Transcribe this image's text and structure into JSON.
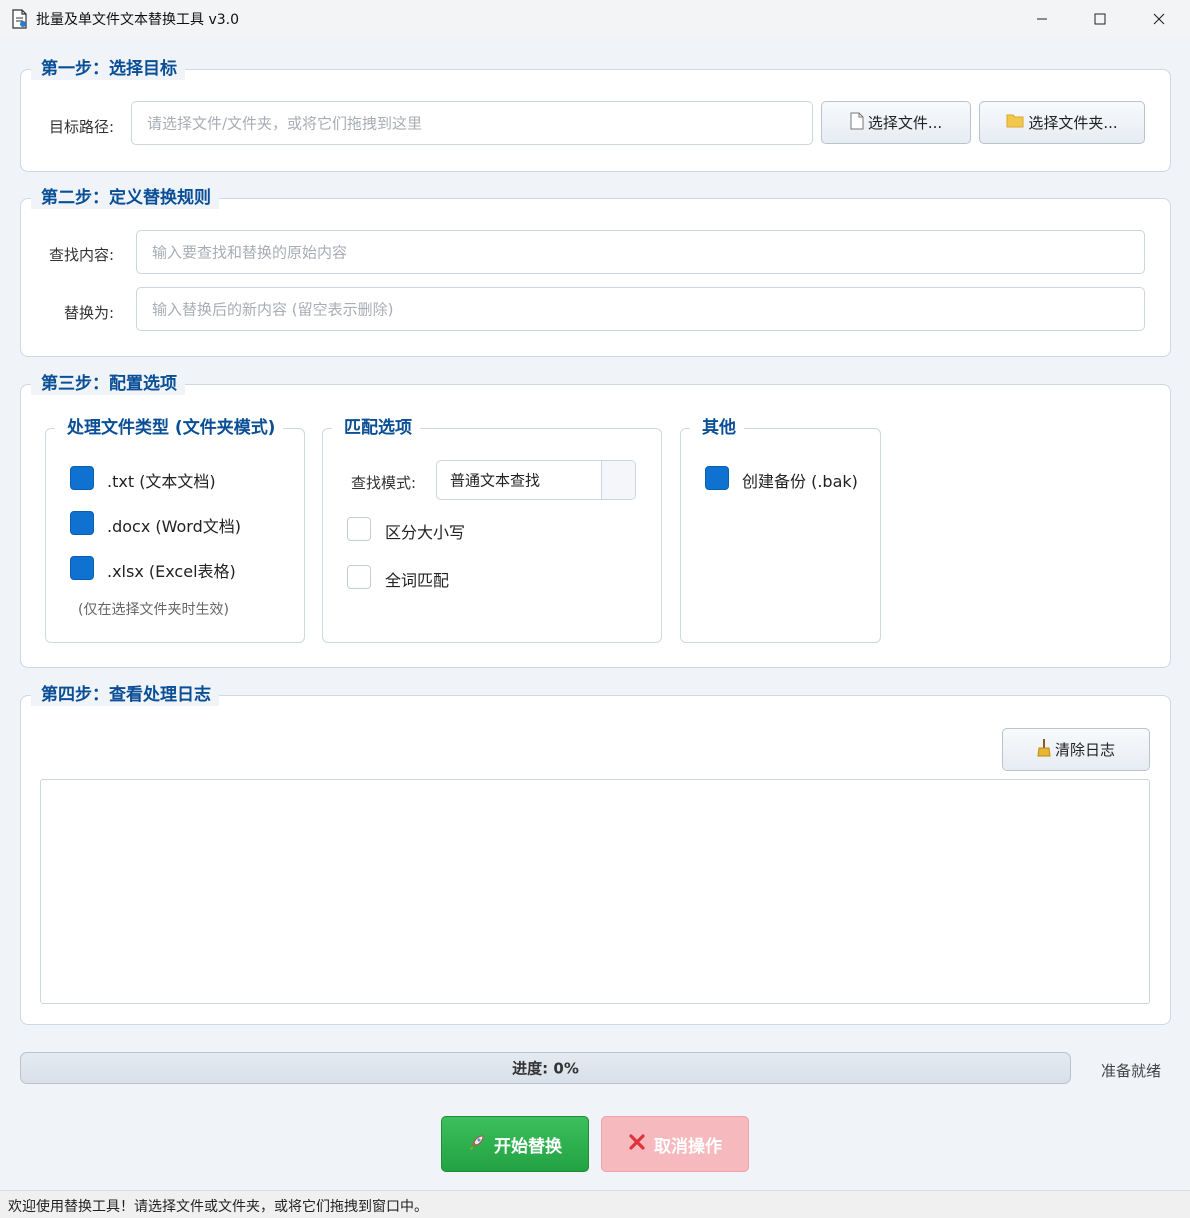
{
  "window": {
    "title": "批量及单文件文本替换工具 v3.0",
    "icons": [
      "app-document-icon",
      "minimize-icon",
      "maximize-icon",
      "close-icon"
    ]
  },
  "step1": {
    "title": "第一步：选择目标",
    "path_label": "目标路径:",
    "path_placeholder": "请选择文件/文件夹，或将它们拖拽到这里",
    "select_file_button": "选择文件...",
    "select_folder_button": "选择文件夹..."
  },
  "step2": {
    "title": "第二步：定义替换规则",
    "find_label": "查找内容:",
    "find_placeholder": "输入要查找和替换的原始内容",
    "replace_label": "替换为:",
    "replace_placeholder": "输入替换后的新内容 (留空表示删除)"
  },
  "step3": {
    "title": "第三步：配置选项",
    "file_types": {
      "title": "处理文件类型 (文件夹模式)",
      "options": [
        {
          "label": ".txt (文本文档)",
          "checked": true
        },
        {
          "label": ".docx (Word文档)",
          "checked": true
        },
        {
          "label": ".xlsx (Excel表格)",
          "checked": true
        }
      ],
      "hint": "(仅在选择文件夹时生效)"
    },
    "match": {
      "title": "匹配选项",
      "mode_label": "查找模式:",
      "mode_value": "普通文本查找",
      "options": [
        {
          "label": "区分大小写",
          "checked": false
        },
        {
          "label": "全词匹配",
          "checked": false
        }
      ]
    },
    "other": {
      "title": "其他",
      "options": [
        {
          "label": "创建备份 (.bak)",
          "checked": true
        }
      ]
    }
  },
  "step4": {
    "title": "第四步：查看处理日志",
    "clear_button": "清除日志",
    "log_content": ""
  },
  "progress": {
    "text": "进度: 0%",
    "value": 0,
    "status": "准备就绪"
  },
  "actions": {
    "start_label": "开始替换",
    "cancel_label": "取消操作"
  },
  "statusbar": {
    "text": "欢迎使用替换工具！请选择文件或文件夹，或将它们拖拽到窗口中。"
  },
  "colors": {
    "accent": "#0f72d1",
    "heading": "#0a4f96",
    "start_button": "#2eae4e",
    "cancel_button": "#f6b9bd"
  }
}
